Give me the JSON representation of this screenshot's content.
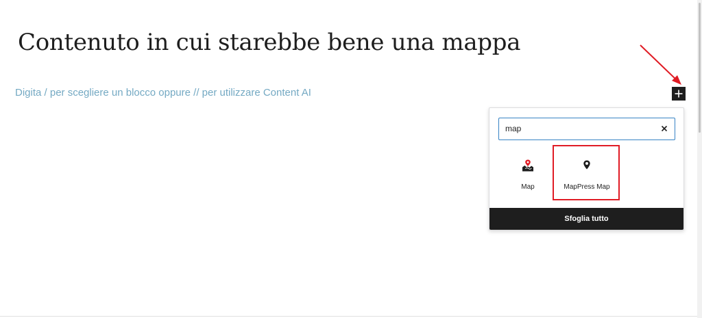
{
  "editor": {
    "heading": "Contenuto in cui starebbe bene una mappa",
    "placeholder": "Digita / per scegliere un blocco oppure // per utilizzare Content AI"
  },
  "inserter": {
    "toggle_icon": "plus-icon",
    "search": {
      "value": "map",
      "clear_icon": "close-icon"
    },
    "results": [
      {
        "label": "Map",
        "icon": "map-pin-landscape-icon",
        "icon_color": "#e01b24"
      },
      {
        "label": "MapPress Map",
        "icon": "map-marker-icon"
      }
    ],
    "browse_all_label": "Sfoglia tutto"
  },
  "annotations": {
    "color": "#e01b24"
  },
  "colors": {
    "placeholder": "#74a9c3",
    "dark": "#1e1e1e",
    "focus": "#3582c4"
  }
}
